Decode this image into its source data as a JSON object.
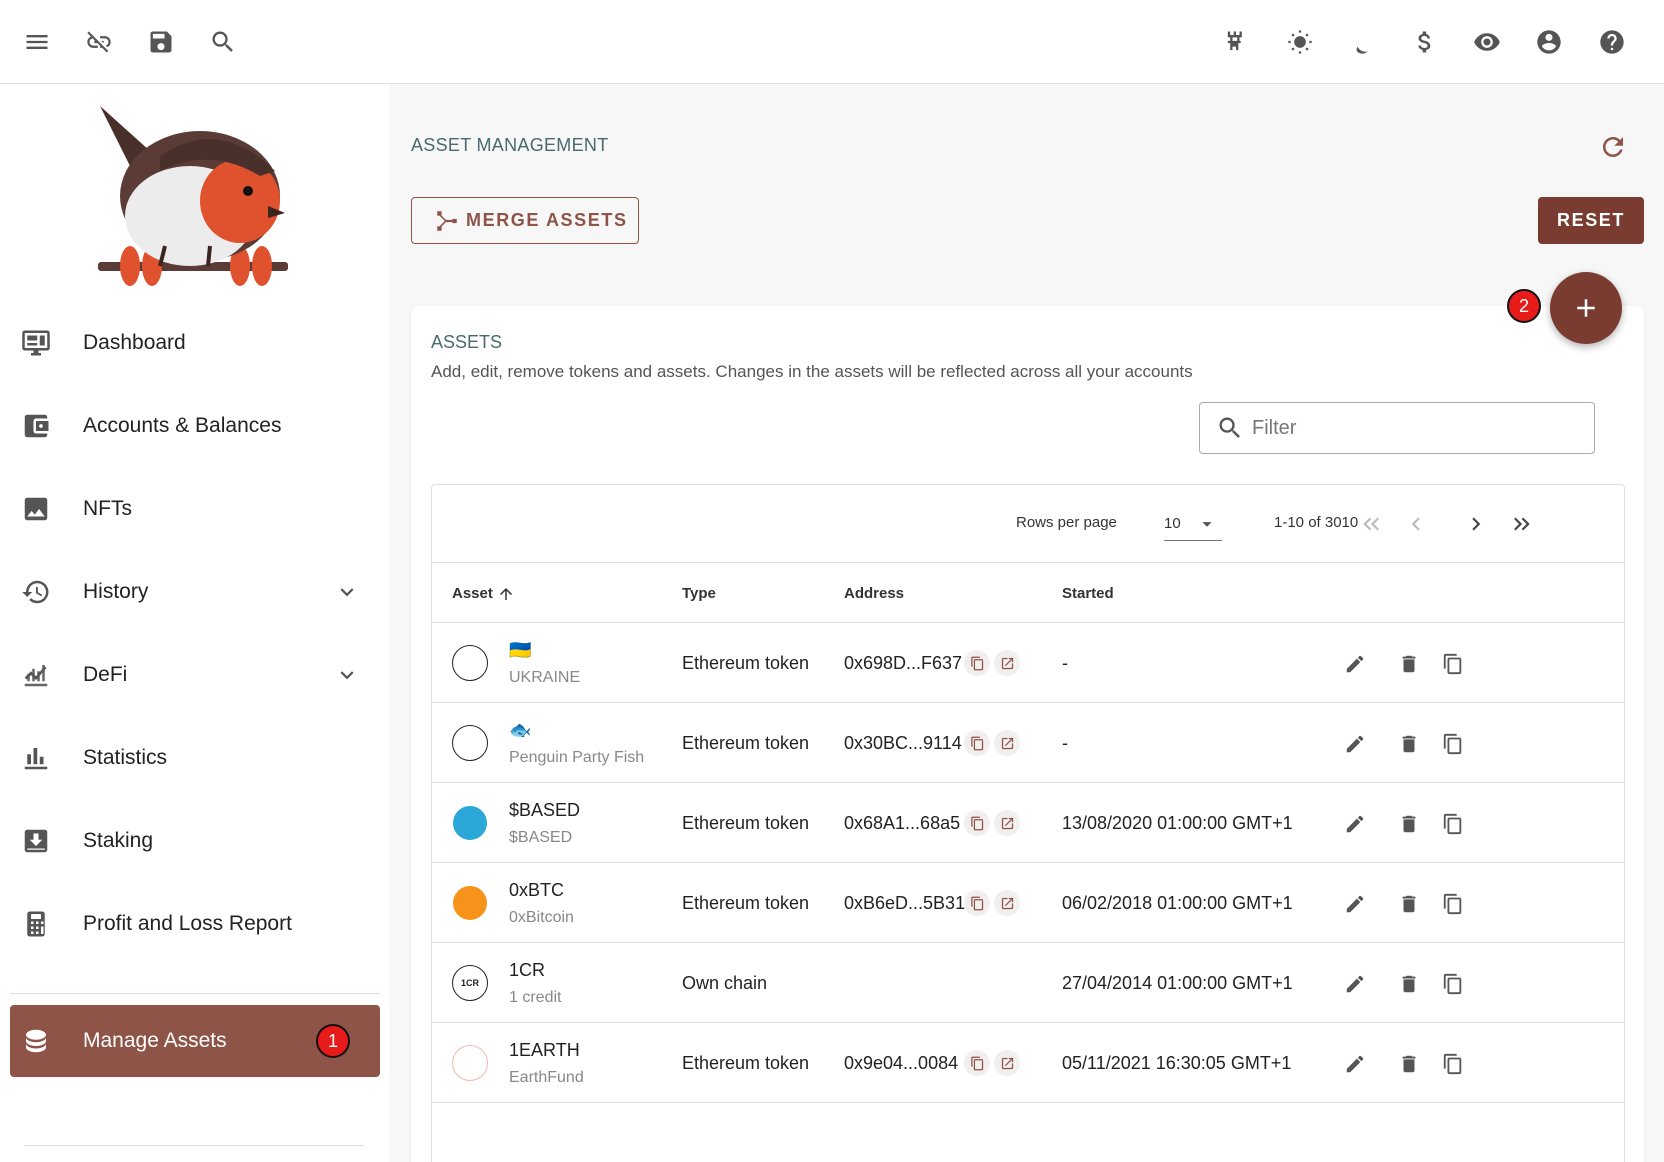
{
  "topbar": {
    "left_icons": [
      "menu-icon",
      "link-off-icon",
      "save-icon",
      "search-icon"
    ],
    "right_icons": [
      "node-icon",
      "light-mode-icon",
      "dark-mode-icon",
      "currency-icon",
      "privacy-eye-icon",
      "account-icon",
      "help-icon"
    ]
  },
  "sidebar": {
    "items": [
      {
        "label": "Dashboard",
        "icon": "dashboard-icon"
      },
      {
        "label": "Accounts & Balances",
        "icon": "wallet-icon"
      },
      {
        "label": "NFTs",
        "icon": "image-icon"
      },
      {
        "label": "History",
        "icon": "history-icon",
        "expandable": true
      },
      {
        "label": "DeFi",
        "icon": "defi-chart-icon",
        "expandable": true
      },
      {
        "label": "Statistics",
        "icon": "bar-chart-icon"
      },
      {
        "label": "Staking",
        "icon": "staking-icon"
      },
      {
        "label": "Profit and Loss Report",
        "icon": "calculator-icon"
      },
      {
        "label": "Manage Assets",
        "icon": "database-icon",
        "active": true
      }
    ],
    "badge_1": "1"
  },
  "main": {
    "title": "ASSET MANAGEMENT",
    "merge_label": "MERGE ASSETS",
    "reset_label": "RESET",
    "badge_2": "2"
  },
  "card": {
    "title": "ASSETS",
    "subtitle": "Add, edit, remove tokens and assets. Changes in the assets will be reflected across all your accounts",
    "filter_placeholder": "Filter"
  },
  "pager": {
    "rows_per_page_label": "Rows per page",
    "rows_per_page": "10",
    "range": "1-10 of 3010"
  },
  "table": {
    "headers": {
      "asset": "Asset",
      "type": "Type",
      "address": "Address",
      "started": "Started"
    },
    "rows": [
      {
        "icon_text": "",
        "symbol": "🇺🇦",
        "name": "UKRAINE",
        "type": "Ethereum token",
        "address": "0x698D...F637",
        "started": "-"
      },
      {
        "icon_text": "",
        "symbol": "🐟",
        "name": "Penguin Party Fish",
        "type": "Ethereum token",
        "address": "0x30BC...9114",
        "started": "-"
      },
      {
        "icon_text": "",
        "symbol": "$BASED",
        "name": "$BASED",
        "type": "Ethereum token",
        "address": "0x68A1...68a5",
        "started": "13/08/2020 01:00:00 GMT+1"
      },
      {
        "icon_text": "",
        "symbol": "0xBTC",
        "name": "0xBitcoin",
        "type": "Ethereum token",
        "address": "0xB6eD...5B31",
        "started": "06/02/2018 01:00:00 GMT+1"
      },
      {
        "icon_text": "1CR",
        "symbol": "1CR",
        "name": "1 credit",
        "type": "Own chain",
        "address": "",
        "started": "27/04/2014 01:00:00 GMT+1"
      },
      {
        "icon_text": "",
        "symbol": "1EARTH",
        "name": "EarthFund",
        "type": "Ethereum token",
        "address": "0x9e04...0084",
        "started": "05/11/2021 16:30:05 GMT+1"
      }
    ]
  },
  "colors": {
    "accent": "#8e5447",
    "accent_dark": "#7a3c30",
    "title_teal": "#4a6a6e",
    "badge_red": "#e81b1b"
  }
}
